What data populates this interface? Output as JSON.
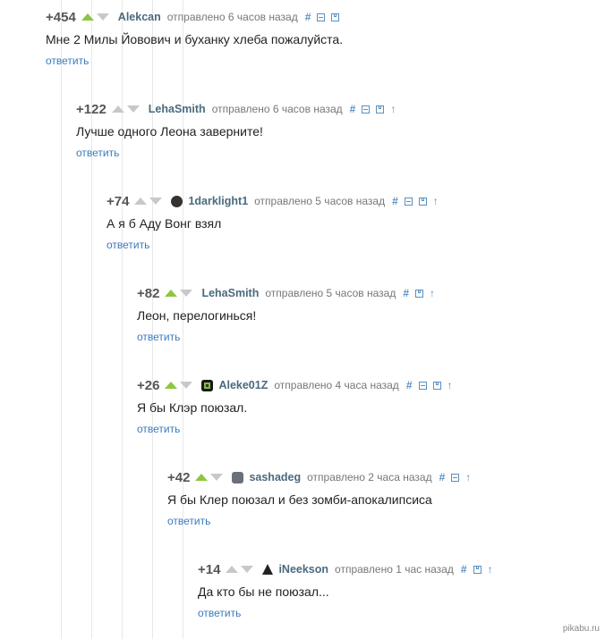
{
  "reply_label": "ответить",
  "comments": [
    {
      "rating": "+454",
      "up_active": true,
      "author": "Alekcan",
      "avatar": "",
      "time": "отправлено 6 часов назад",
      "text": "Мне 2 Милы Йовович и буханку хлеба пожалуйста.",
      "icons": [
        "hash",
        "minus",
        "save"
      ]
    },
    {
      "rating": "+122",
      "up_active": false,
      "author": "LehaSmith",
      "avatar": "",
      "time": "отправлено 6 часов назад",
      "text": "Лучше одного Леона заверните!",
      "icons": [
        "hash",
        "minus",
        "save",
        "parent"
      ]
    },
    {
      "rating": "+74",
      "up_active": false,
      "author": "1darklight1",
      "avatar": "dark",
      "time": "отправлено 5 часов назад",
      "text": "А я б Аду Вонг взял",
      "icons": [
        "hash",
        "minus",
        "save",
        "parent"
      ]
    },
    {
      "rating": "+82",
      "up_active": true,
      "author": "LehaSmith",
      "avatar": "",
      "time": "отправлено 5 часов назад",
      "text": "Леон, перелогинься!",
      "icons": [
        "hash",
        "save",
        "parent"
      ]
    },
    {
      "rating": "+26",
      "up_active": true,
      "author": "Aleke01Z",
      "avatar": "green",
      "time": "отправлено 4 часа назад",
      "text": "Я бы Клэр поюзал.",
      "icons": [
        "hash",
        "minus",
        "save",
        "parent"
      ]
    },
    {
      "rating": "+42",
      "up_active": true,
      "author": "sashadeg",
      "avatar": "gray",
      "time": "отправлено 2 часа назад",
      "text": "Я бы Клер поюзал и без зомби-апокалипсиса",
      "icons": [
        "hash",
        "minus",
        "parent"
      ]
    },
    {
      "rating": "+14",
      "up_active": false,
      "author": "iNeekson",
      "avatar": "triangle",
      "time": "отправлено 1 час назад",
      "text": "Да кто бы не поюзал...",
      "icons": [
        "hash",
        "save",
        "parent"
      ]
    }
  ],
  "watermark": "pikabu.ru"
}
